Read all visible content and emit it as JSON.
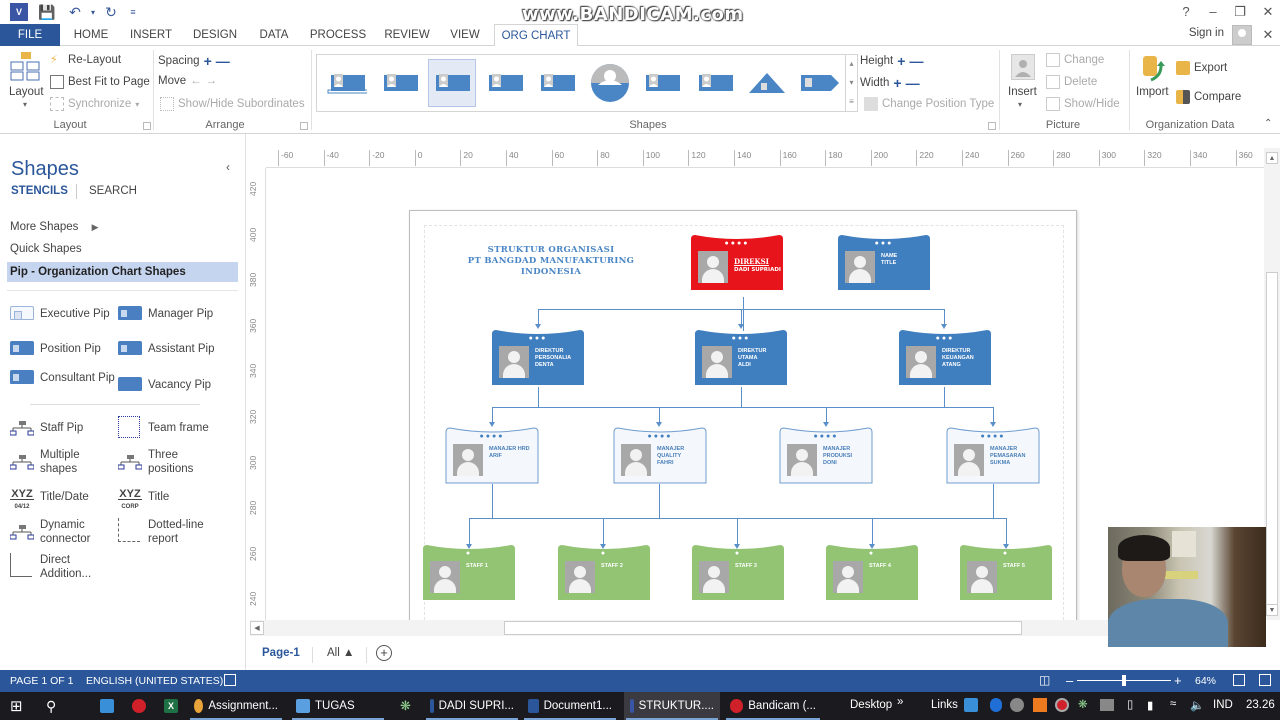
{
  "app": {
    "watermark": "www.BANDICAM.com",
    "quick_access": [
      "visio-icon",
      "save-icon",
      "undo-icon",
      "redo-icon",
      "customize-icon"
    ],
    "window_controls": [
      "?",
      "–",
      "❐",
      "✕"
    ],
    "sign_in": "Sign in"
  },
  "ribbon_tabs": [
    "FILE",
    "HOME",
    "INSERT",
    "DESIGN",
    "DATA",
    "PROCESS",
    "REVIEW",
    "VIEW",
    "ORG CHART"
  ],
  "active_tab": "ORG CHART",
  "ribbon": {
    "layout_group": {
      "label": "Layout",
      "layout_button": "Layout",
      "relayout": "Re-Layout",
      "best_fit": "Best Fit to Page",
      "synchronize": "Synchronize"
    },
    "arrange_group": {
      "label": "Arrange",
      "spacing": "Spacing",
      "move": "Move",
      "show_hide_subordinates": "Show/Hide Subordinates"
    },
    "shapes_group": {
      "label": "Shapes",
      "height": "Height",
      "width": "Width",
      "change_position_type": "Change Position Type",
      "gallery_count": 10,
      "selected_index": 2
    },
    "picture_group": {
      "label": "Picture",
      "insert": "Insert",
      "change": "Change",
      "delete": "Delete",
      "show_hide": "Show/Hide"
    },
    "org_data_group": {
      "label": "Organization Data",
      "import": "Import",
      "export": "Export",
      "compare": "Compare"
    }
  },
  "shapes_panel": {
    "title": "Shapes",
    "tabs": [
      "STENCILS",
      "SEARCH"
    ],
    "more_shapes": "More Shapes",
    "quick_shapes": "Quick Shapes",
    "active_stencil": "Pip - Organization Chart Shapes",
    "stencils": [
      {
        "label": "Executive Pip",
        "icon": "executive-pip-icon"
      },
      {
        "label": "Manager Pip",
        "icon": "manager-pip-icon"
      },
      {
        "label": "Position Pip",
        "icon": "position-pip-icon"
      },
      {
        "label": "Assistant Pip",
        "icon": "assistant-pip-icon"
      },
      {
        "label": "Consultant Pip",
        "icon": "consultant-pip-icon"
      },
      {
        "label": "Vacancy Pip",
        "icon": "vacancy-pip-icon"
      },
      {
        "label": "Staff Pip",
        "icon": "staff-pip-icon"
      },
      {
        "label": "Team frame",
        "icon": "team-frame-icon"
      },
      {
        "label": "Multiple shapes",
        "icon": "multiple-shapes-icon"
      },
      {
        "label": "Three positions",
        "icon": "three-positions-icon"
      },
      {
        "label": "Title/Date",
        "icon": "title-date-icon"
      },
      {
        "label": "Title",
        "icon": "title-icon"
      },
      {
        "label": "Dynamic connector",
        "icon": "dynamic-connector-icon"
      },
      {
        "label": "Dotted-line report",
        "icon": "dotted-line-report-icon"
      },
      {
        "label": "Direct Addition...",
        "icon": "direct-addition-icon"
      }
    ]
  },
  "rulers": {
    "horizontal": [
      "-60",
      "-40",
      "-20",
      "0",
      "20",
      "40",
      "60",
      "80",
      "100",
      "120",
      "140",
      "160",
      "180",
      "200",
      "220",
      "240",
      "260",
      "280",
      "300",
      "320",
      "340",
      "360"
    ],
    "vertical": [
      "420",
      "400",
      "380",
      "360",
      "340",
      "320",
      "300",
      "280",
      "260",
      "240"
    ]
  },
  "org_chart": {
    "title_lines": [
      "STRUKTUR ORGANISASI",
      "PT BANGDAD MANUFAKTURING",
      "INDONESIA"
    ],
    "colors": {
      "executive": "#e8141b",
      "director": "#3f7ebf",
      "manager": "#f4f8fc",
      "staff": "#92c474",
      "connector": "#5b8fc9",
      "title": "#4a86c5"
    },
    "executive": {
      "title": "DIREKSI",
      "name": "DADI SUPRIADI"
    },
    "assistant": {
      "title": "Name",
      "name": "Title"
    },
    "directors": [
      {
        "title": "DIREKTUR PERSONALIA",
        "name": "DENTA"
      },
      {
        "title": "DIREKTUR UTAMA",
        "name": "ALDI"
      },
      {
        "title": "DIREKTUR KEUANGAN",
        "name": "ATANG"
      }
    ],
    "managers": [
      {
        "title": "MANAJER HRD",
        "name": "ARIF"
      },
      {
        "title": "MANAJER QUALITY",
        "name": "FAHRI"
      },
      {
        "title": "MANAJER PRODUKSI",
        "name": "DONI"
      },
      {
        "title": "MANAJER PEMASARAN",
        "name": "SUKMA"
      }
    ],
    "staff": [
      {
        "title": "Staff 1"
      },
      {
        "title": "Staff 2"
      },
      {
        "title": "Staff 3"
      },
      {
        "title": "Staff 4"
      },
      {
        "title": "Staff 5"
      }
    ]
  },
  "page_tabs": {
    "current": "Page-1",
    "all": "All ▲",
    "add": "+"
  },
  "status_bar": {
    "page": "PAGE 1 OF 1",
    "language": "ENGLISH (UNITED STATES)",
    "zoom": "64%",
    "zoom_level_percent": 64
  },
  "taskbar": {
    "items": [
      {
        "label": "Assignment...",
        "icon": "chrome-icon",
        "color": "#e8a33a"
      },
      {
        "label": "TUGAS",
        "icon": "folder-icon",
        "color": "#5aa0e0"
      },
      {
        "label": "DADI SUPRI...",
        "icon": "word-icon",
        "color": "#2b579a"
      },
      {
        "label": "Document1...",
        "icon": "word-icon",
        "color": "#2b579a"
      },
      {
        "label": "STRUKTUR....",
        "icon": "visio-icon",
        "color": "#3955a3"
      },
      {
        "label": "Bandicam (...",
        "icon": "bandicam-icon",
        "color": "#d0202a"
      }
    ],
    "desktop": "Desktop",
    "links": "Links",
    "language": "IND",
    "time": "23.26"
  }
}
